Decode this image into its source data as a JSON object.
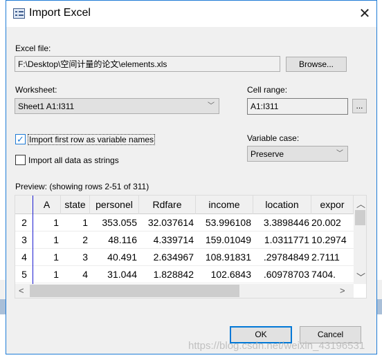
{
  "dialog": {
    "title": "Import Excel",
    "close_icon": "close-icon"
  },
  "excel_file": {
    "label": "Excel file:",
    "value": "F:\\Desktop\\空间计量的论文\\elements.xls",
    "browse": "Browse..."
  },
  "worksheet": {
    "label": "Worksheet:",
    "value": "Sheet1 A1:I311"
  },
  "cell_range": {
    "label": "Cell range:",
    "value": "A1:I311",
    "button": "..."
  },
  "options": {
    "first_row": {
      "label": "Import first row as variable names",
      "checked": true
    },
    "strings": {
      "label": "Import all data as strings",
      "checked": false
    }
  },
  "variable_case": {
    "label": "Variable case:",
    "value": "Preserve"
  },
  "preview": {
    "label": "Preview: (showing rows 2-51 of 311)",
    "headers": [
      "",
      "A",
      "state",
      "personel",
      "Rdfare",
      "income",
      "location",
      "expor"
    ],
    "rows": [
      [
        "2",
        "1",
        "1",
        "353.055",
        "32.037614",
        "53.996108",
        "3.3898446",
        "20.002"
      ],
      [
        "3",
        "1",
        "2",
        "48.116",
        "4.339714",
        "159.01049",
        "1.0311771",
        "10.2974"
      ],
      [
        "4",
        "1",
        "3",
        "40.491",
        "2.634967",
        "108.91831",
        ".29784849",
        "2.7111"
      ],
      [
        "5",
        "1",
        "4",
        "31.044",
        "1.828842",
        "102.6843",
        ".60978703",
        ".7404"
      ]
    ]
  },
  "footer": {
    "ok": "OK",
    "cancel": "Cancel"
  },
  "watermark": "https://blog.csdn.net/weixin_43196531",
  "colors": {
    "accent": "#0078d7",
    "grid_line": "#1a1ad0"
  }
}
